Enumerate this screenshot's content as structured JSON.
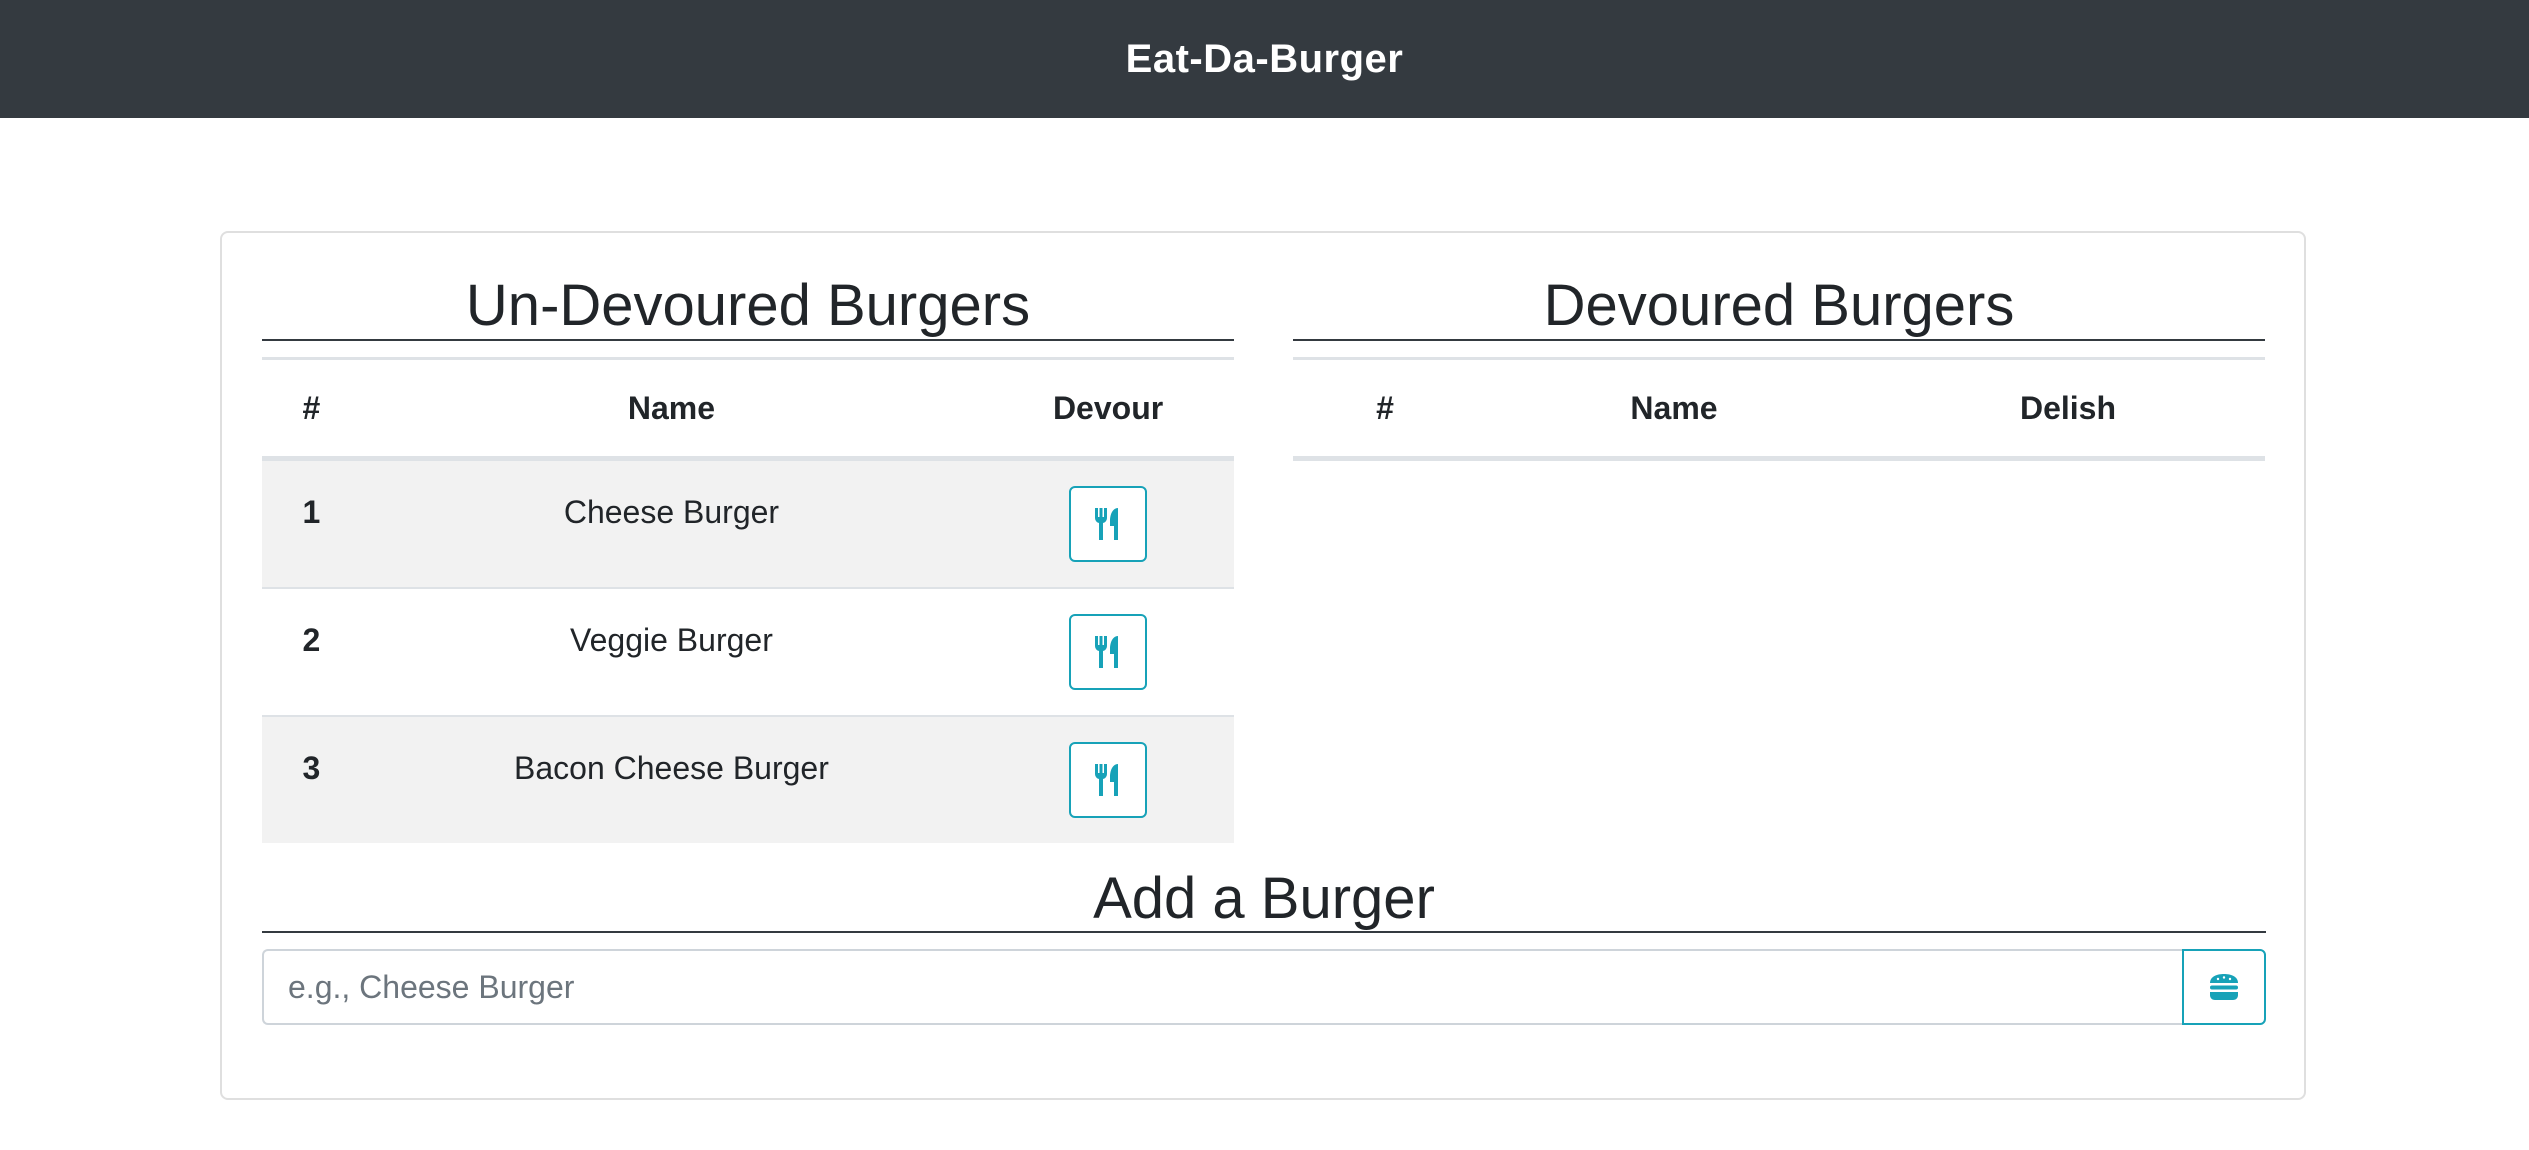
{
  "navbar": {
    "brand": "Eat-Da-Burger"
  },
  "undevoured": {
    "title": "Un-Devoured Burgers",
    "headers": {
      "num": "#",
      "name": "Name",
      "action": "Devour"
    },
    "rows": [
      {
        "num": "1",
        "name": "Cheese Burger",
        "icon": "utensils-icon"
      },
      {
        "num": "2",
        "name": "Veggie Burger",
        "icon": "utensils-icon"
      },
      {
        "num": "3",
        "name": "Bacon Cheese Burger",
        "icon": "utensils-icon"
      }
    ]
  },
  "devoured": {
    "title": "Devoured Burgers",
    "headers": {
      "num": "#",
      "name": "Name",
      "action": "Delish"
    },
    "rows": []
  },
  "add": {
    "title": "Add a Burger",
    "placeholder": "e.g., Cheese Burger",
    "value": "",
    "button_icon": "hamburger-icon"
  },
  "colors": {
    "navbar": "#343a40",
    "accent": "#17a2b8",
    "stripe": "#f2f2f2"
  }
}
